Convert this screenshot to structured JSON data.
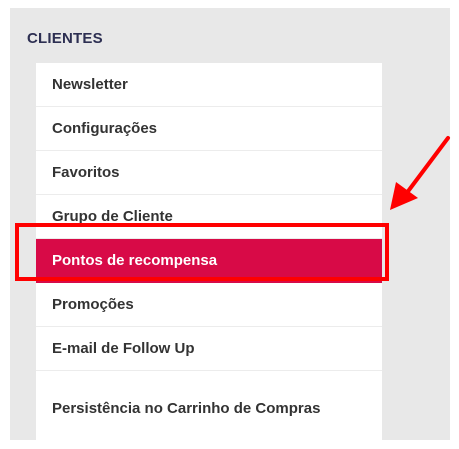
{
  "section": {
    "title": "CLIENTES"
  },
  "menu": {
    "items": [
      {
        "label": "Newsletter",
        "active": false
      },
      {
        "label": "Configurações",
        "active": false
      },
      {
        "label": "Favoritos",
        "active": false
      },
      {
        "label": "Grupo de Cliente",
        "active": false
      },
      {
        "label": "Pontos de recompensa",
        "active": true
      },
      {
        "label": "Promoções",
        "active": false
      },
      {
        "label": "E-mail de Follow Up",
        "active": false
      },
      {
        "label": "Persistência no Carrinho de Compras",
        "active": false
      }
    ]
  },
  "annotation": {
    "highlight_color": "#ff0000",
    "arrow_color": "#ff0000",
    "active_color": "#d80a47",
    "arrow_icon": "arrow-pointer-icon"
  }
}
